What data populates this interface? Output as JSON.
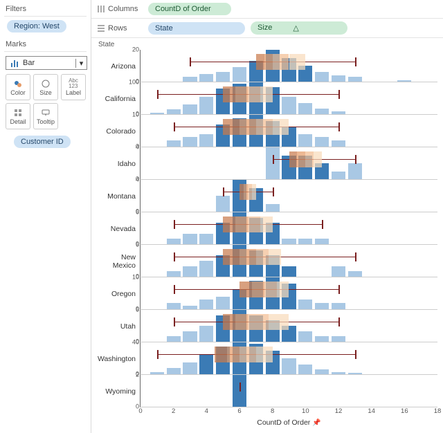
{
  "sidebar": {
    "filters_title": "Filters",
    "filter_pill": "Region: West",
    "marks_title": "Marks",
    "mark_type": "Bar",
    "cards": {
      "color": "Color",
      "size": "Size",
      "label": "Label",
      "detail": "Detail",
      "tooltip": "Tooltip"
    },
    "detail_pill": "Customer ID"
  },
  "shelves": {
    "columns_label": "Columns",
    "columns_pill": "CountD of Order",
    "rows_label": "Rows",
    "rows_pill1": "State",
    "rows_pill2": "Size",
    "rows_pill2_sort": "△"
  },
  "viz_header": "State",
  "x_axis": {
    "title": "CountD of Order",
    "min": 0,
    "max": 18,
    "ticks": [
      0,
      2,
      4,
      6,
      8,
      10,
      12,
      14,
      16,
      18
    ]
  },
  "box_colors": [
    "#3b7bb5",
    "#c97b4e",
    "#e69c6a",
    "#f2be93",
    "#f8dbbb"
  ],
  "chart_data": {
    "type": "bar",
    "title": "",
    "xlabel": "CountD of Order",
    "ylabel": "",
    "note": "Histogram of distinct-order-count per customer, faceted by State, with overlaid box-and-whisker summary. Values estimated from pixels.",
    "facets": [
      {
        "state": "Arizona",
        "ymax": 20,
        "yticks": [
          0,
          20
        ],
        "bars": [
          {
            "x": 3,
            "y": 3
          },
          {
            "x": 4,
            "y": 5
          },
          {
            "x": 5,
            "y": 6
          },
          {
            "x": 6,
            "y": 9
          },
          {
            "x": 7,
            "y": 13
          },
          {
            "x": 8,
            "y": 20
          },
          {
            "x": 9,
            "y": 15
          },
          {
            "x": 10,
            "y": 10
          },
          {
            "x": 11,
            "y": 6
          },
          {
            "x": 12,
            "y": 4
          },
          {
            "x": 13,
            "y": 3
          },
          {
            "x": 16,
            "y": 1
          }
        ],
        "box": {
          "low": 3,
          "q1": 7,
          "median": 8,
          "q3": 10,
          "high": 13
        }
      },
      {
        "state": "California",
        "ymax": 100,
        "yticks": [
          0,
          100
        ],
        "bars": [
          {
            "x": 1,
            "y": 5
          },
          {
            "x": 2,
            "y": 15
          },
          {
            "x": 3,
            "y": 30
          },
          {
            "x": 4,
            "y": 55
          },
          {
            "x": 5,
            "y": 80
          },
          {
            "x": 6,
            "y": 95
          },
          {
            "x": 7,
            "y": 100
          },
          {
            "x": 8,
            "y": 85
          },
          {
            "x": 9,
            "y": 55
          },
          {
            "x": 10,
            "y": 35
          },
          {
            "x": 11,
            "y": 18
          },
          {
            "x": 12,
            "y": 8
          }
        ],
        "box": {
          "low": 1,
          "q1": 5,
          "median": 6.5,
          "q3": 8,
          "high": 12
        }
      },
      {
        "state": "Colorado",
        "ymax": 10,
        "yticks": [
          0,
          10
        ],
        "bars": [
          {
            "x": 2,
            "y": 2
          },
          {
            "x": 3,
            "y": 3
          },
          {
            "x": 4,
            "y": 4
          },
          {
            "x": 5,
            "y": 7
          },
          {
            "x": 6,
            "y": 9
          },
          {
            "x": 7,
            "y": 10
          },
          {
            "x": 8,
            "y": 8
          },
          {
            "x": 9,
            "y": 6
          },
          {
            "x": 10,
            "y": 4
          },
          {
            "x": 11,
            "y": 3
          },
          {
            "x": 12,
            "y": 2
          }
        ],
        "box": {
          "low": 2,
          "q1": 5,
          "median": 7,
          "q3": 9,
          "high": 12
        }
      },
      {
        "state": "Idaho",
        "ymax": 4,
        "yticks": [
          0,
          4
        ],
        "bars": [
          {
            "x": 8,
            "y": 4
          },
          {
            "x": 9,
            "y": 3
          },
          {
            "x": 10,
            "y": 3
          },
          {
            "x": 11,
            "y": 2
          },
          {
            "x": 12,
            "y": 1
          },
          {
            "x": 13,
            "y": 2
          }
        ],
        "box": {
          "low": 8,
          "q1": 9,
          "median": 10,
          "q3": 11,
          "high": 13
        }
      },
      {
        "state": "Montana",
        "ymax": 4,
        "yticks": [
          0,
          4
        ],
        "bars": [
          {
            "x": 5,
            "y": 2
          },
          {
            "x": 6,
            "y": 4
          },
          {
            "x": 7,
            "y": 3
          },
          {
            "x": 8,
            "y": 1
          }
        ],
        "box": {
          "low": 5,
          "q1": 6,
          "median": 6.5,
          "q3": 7,
          "high": 8
        }
      },
      {
        "state": "Nevada",
        "ymax": 6,
        "yticks": [
          0,
          6
        ],
        "bars": [
          {
            "x": 2,
            "y": 1
          },
          {
            "x": 3,
            "y": 2
          },
          {
            "x": 4,
            "y": 2
          },
          {
            "x": 5,
            "y": 4
          },
          {
            "x": 6,
            "y": 6
          },
          {
            "x": 7,
            "y": 5
          },
          {
            "x": 8,
            "y": 4
          },
          {
            "x": 9,
            "y": 1
          },
          {
            "x": 10,
            "y": 1
          },
          {
            "x": 11,
            "y": 1
          }
        ],
        "box": {
          "low": 2,
          "q1": 5,
          "median": 6.5,
          "q3": 8,
          "high": 11
        }
      },
      {
        "state": "New Mexico",
        "ymax": 6,
        "yticks": [
          0,
          6
        ],
        "bars": [
          {
            "x": 2,
            "y": 1
          },
          {
            "x": 3,
            "y": 2
          },
          {
            "x": 4,
            "y": 3
          },
          {
            "x": 5,
            "y": 4
          },
          {
            "x": 6,
            "y": 6
          },
          {
            "x": 7,
            "y": 5
          },
          {
            "x": 8,
            "y": 4
          },
          {
            "x": 9,
            "y": 2
          },
          {
            "x": 12,
            "y": 2
          },
          {
            "x": 13,
            "y": 1
          }
        ],
        "box": {
          "low": 2,
          "q1": 5,
          "median": 7,
          "q3": 8.5,
          "high": 13
        }
      },
      {
        "state": "Oregon",
        "ymax": 10,
        "yticks": [
          0,
          10
        ],
        "bars": [
          {
            "x": 2,
            "y": 2
          },
          {
            "x": 3,
            "y": 1
          },
          {
            "x": 4,
            "y": 3
          },
          {
            "x": 5,
            "y": 4
          },
          {
            "x": 6,
            "y": 6
          },
          {
            "x": 7,
            "y": 9
          },
          {
            "x": 8,
            "y": 10
          },
          {
            "x": 9,
            "y": 8
          },
          {
            "x": 10,
            "y": 3
          },
          {
            "x": 11,
            "y": 2
          },
          {
            "x": 12,
            "y": 2
          }
        ],
        "box": {
          "low": 2,
          "q1": 6,
          "median": 7.5,
          "q3": 9,
          "high": 12
        }
      },
      {
        "state": "Utah",
        "ymax": 6,
        "yticks": [
          0,
          6
        ],
        "bars": [
          {
            "x": 2,
            "y": 1
          },
          {
            "x": 3,
            "y": 2
          },
          {
            "x": 4,
            "y": 3
          },
          {
            "x": 5,
            "y": 5
          },
          {
            "x": 6,
            "y": 6
          },
          {
            "x": 7,
            "y": 5
          },
          {
            "x": 8,
            "y": 4
          },
          {
            "x": 9,
            "y": 3
          },
          {
            "x": 10,
            "y": 2
          },
          {
            "x": 11,
            "y": 1
          },
          {
            "x": 12,
            "y": 1
          }
        ],
        "box": {
          "low": 2,
          "q1": 5,
          "median": 6.5,
          "q3": 9,
          "high": 12
        }
      },
      {
        "state": "Washington",
        "ymax": 40,
        "yticks": [
          0,
          40
        ],
        "bars": [
          {
            "x": 1,
            "y": 3
          },
          {
            "x": 2,
            "y": 8
          },
          {
            "x": 3,
            "y": 15
          },
          {
            "x": 4,
            "y": 25
          },
          {
            "x": 5,
            "y": 35
          },
          {
            "x": 6,
            "y": 40
          },
          {
            "x": 7,
            "y": 38
          },
          {
            "x": 8,
            "y": 30
          },
          {
            "x": 9,
            "y": 20
          },
          {
            "x": 10,
            "y": 12
          },
          {
            "x": 11,
            "y": 6
          },
          {
            "x": 12,
            "y": 3
          },
          {
            "x": 13,
            "y": 2
          }
        ],
        "box": {
          "low": 1,
          "q1": 4.5,
          "median": 6,
          "q3": 8,
          "high": 13
        }
      },
      {
        "state": "Wyoming",
        "ymax": 2,
        "yticks": [
          0,
          2
        ],
        "bars": [
          {
            "x": 6,
            "y": 2
          }
        ],
        "box": {
          "low": 6,
          "q1": 6,
          "median": 6,
          "q3": 6,
          "high": 6
        }
      }
    ]
  }
}
